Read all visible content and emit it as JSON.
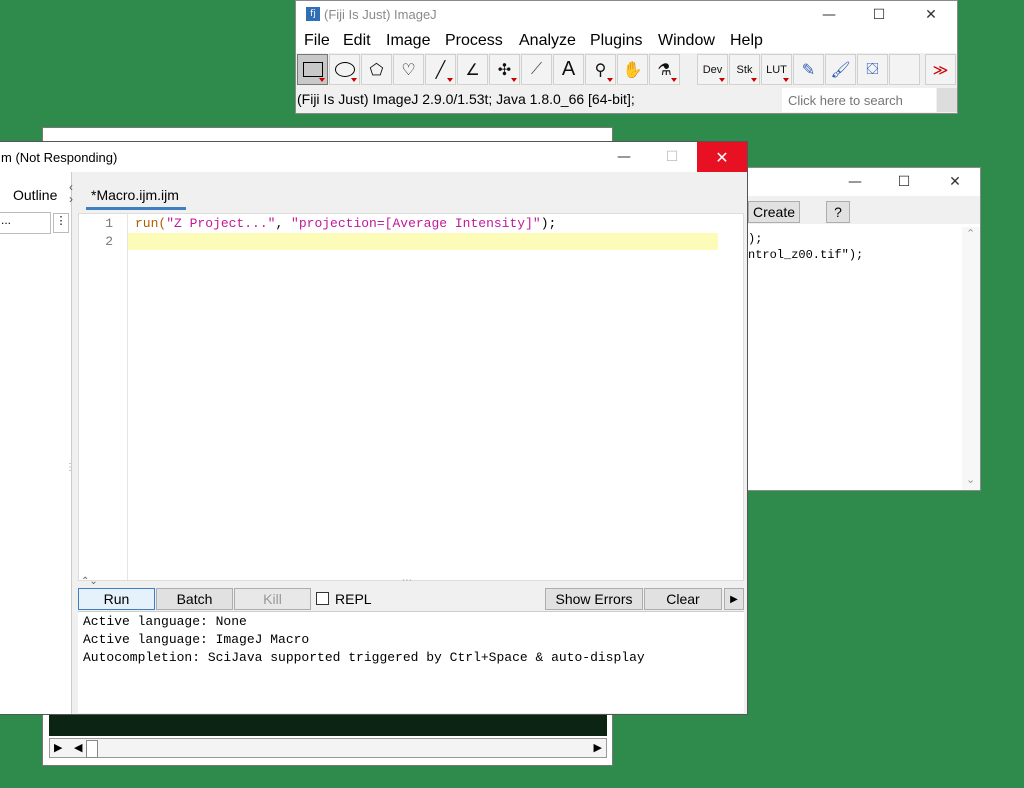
{
  "imagej": {
    "title": "(Fiji Is Just) ImageJ",
    "menu": [
      "File",
      "Edit",
      "Image",
      "Process",
      "Analyze",
      "Plugins",
      "Window",
      "Help"
    ],
    "tools": {
      "dev": "Dev",
      "stk": "Stk",
      "lut": "LUT",
      "more": "≫"
    },
    "status": "(Fiji Is Just) ImageJ 2.9.0/1.53t; Java 1.8.0_66 [64-bit];",
    "search_placeholder": "Click here to search"
  },
  "recorder": {
    "create_label": "Create",
    "help_label": "?",
    "code_lines": [
      ");",
      "ntrol_z00.tif\");"
    ]
  },
  "editor": {
    "title": "m (Not Responding)",
    "outline_label": "Outline",
    "side_field": "...",
    "tab_label": "*Macro.ijm.ijm",
    "line_numbers": [
      "1",
      "2"
    ],
    "code": {
      "fn": "run(",
      "arg1": "\"Z Project...\"",
      "sep": ", ",
      "arg2": "\"projection=[Average Intensity]\"",
      "end": ");"
    },
    "buttons": {
      "run": "Run",
      "batch": "Batch",
      "kill": "Kill",
      "repl": "REPL",
      "show_errors": "Show Errors",
      "clear": "Clear"
    },
    "console": [
      "Active language: None",
      "Active language: ImageJ Macro",
      "Autocompletion: SciJava supported triggered by Ctrl+Space & auto-display"
    ]
  },
  "colors": {
    "desktop": "#2e8b4c",
    "close_red": "#e81123",
    "code_string": "#c2189b",
    "code_fn": "#b35c00",
    "tab_underline": "#3d7fc1"
  }
}
